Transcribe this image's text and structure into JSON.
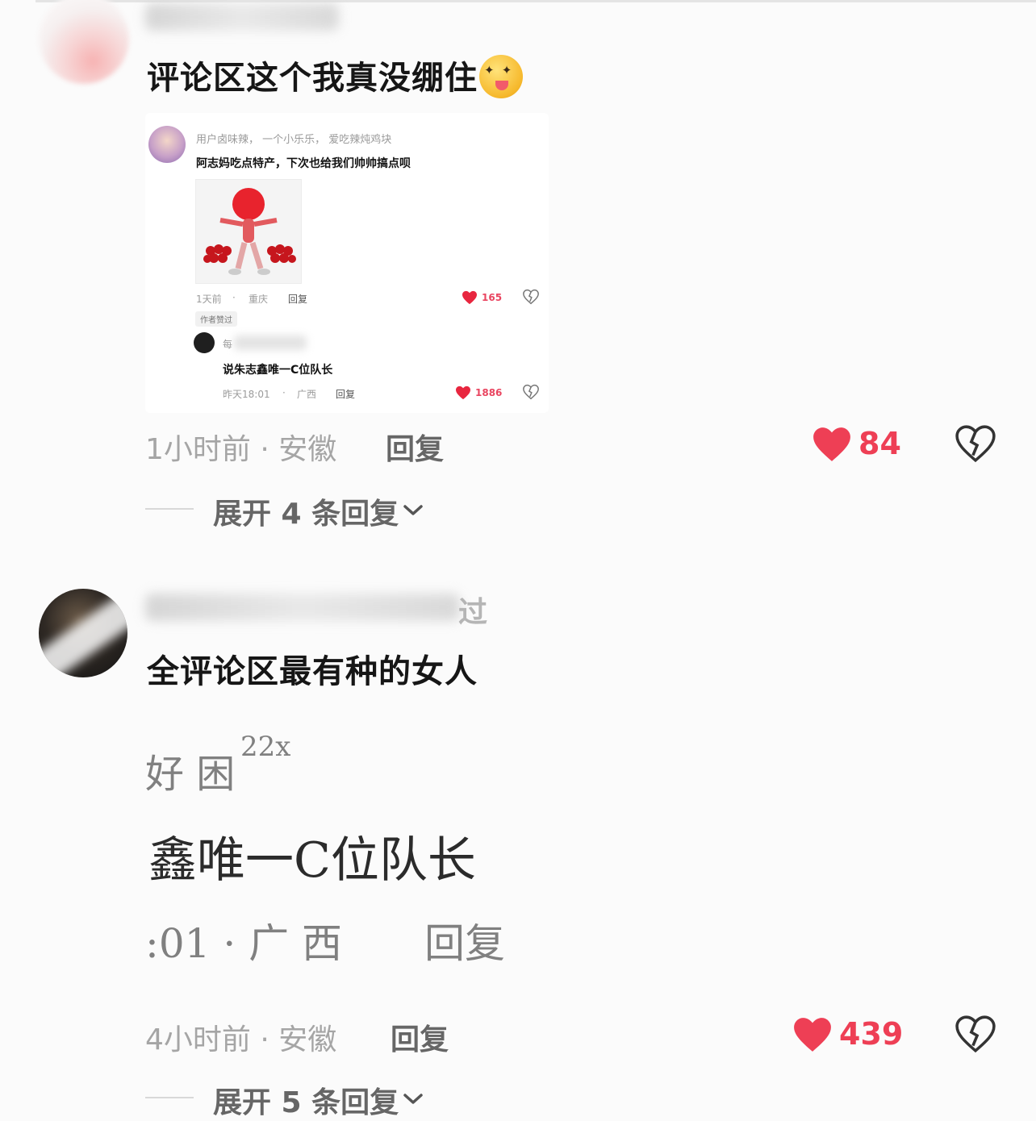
{
  "comments": [
    {
      "text": "评论区这个我真没绷住",
      "time_location": "1小时前 · 安徽",
      "reply_label": "回复",
      "like_count": "84",
      "expand_label": "展开 4 条回复",
      "embedded_screenshot": {
        "user_line": "用户卤味辣， 一个小乐乐， 爱吃辣炖鸡块",
        "text": "阿志妈吃点特产，下次也给我们帅帅搞点呗",
        "time": "1天前",
        "location": "重庆",
        "reply_label": "回复",
        "like_count": "165",
        "author_badge": "作者赞过",
        "sub_reply": {
          "name": "每",
          "text": "说朱志鑫唯一C位队长",
          "time": "昨天18:01",
          "location": "广西",
          "reply_label": "回复",
          "like_count": "1886"
        }
      }
    },
    {
      "name_suffix": "过",
      "text": "全评论区最有种的女人",
      "time_location": "4小时前 · 安徽",
      "reply_label": "回复",
      "like_count": "439",
      "expand_label": "展开 5 条回复",
      "zoomed_image": {
        "line1": "好 困",
        "line1_sup": "22x",
        "line2": "鑫唯一C位队长",
        "line3": ":01 · 广 西",
        "line3_reply": "回复"
      }
    }
  ],
  "colors": {
    "like_red": "#ee3f55",
    "meta_gray": "#a5a5a5"
  },
  "icons": [
    "heart-icon",
    "broken-heart-icon",
    "chevron-down-icon"
  ]
}
